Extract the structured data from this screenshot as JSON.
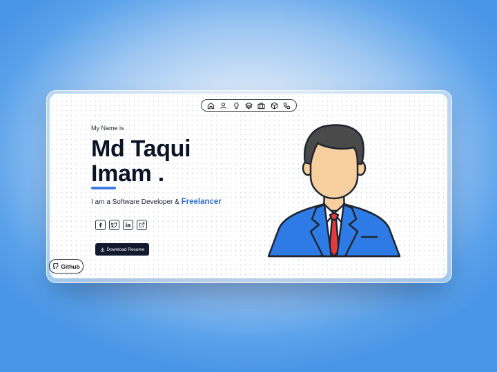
{
  "nav": {
    "icons": [
      "home-icon",
      "user-icon",
      "lightbulb-icon",
      "layers-icon",
      "briefcase-icon",
      "box-icon",
      "phone-icon"
    ]
  },
  "hero": {
    "eyebrow": "My Name is",
    "name_line1": "Md Taqui",
    "name_line2": "Imam .",
    "tagline_prefix": "I am a Software Developer & ",
    "tagline_highlight": "Freelancer"
  },
  "socials": [
    "facebook-icon",
    "twitter-icon",
    "linkedin-icon",
    "external-link-icon"
  ],
  "download_button": {
    "label": "Download Resume"
  },
  "github_button": {
    "label": "Github"
  },
  "colors": {
    "accent": "#2e6fd6",
    "dark": "#0b1326",
    "button_bg": "#111a2e",
    "suit_blue": "#2f7be6",
    "tie_red": "#e23b3b",
    "hair": "#4a4a4a",
    "skin": "#f8d0a0"
  }
}
